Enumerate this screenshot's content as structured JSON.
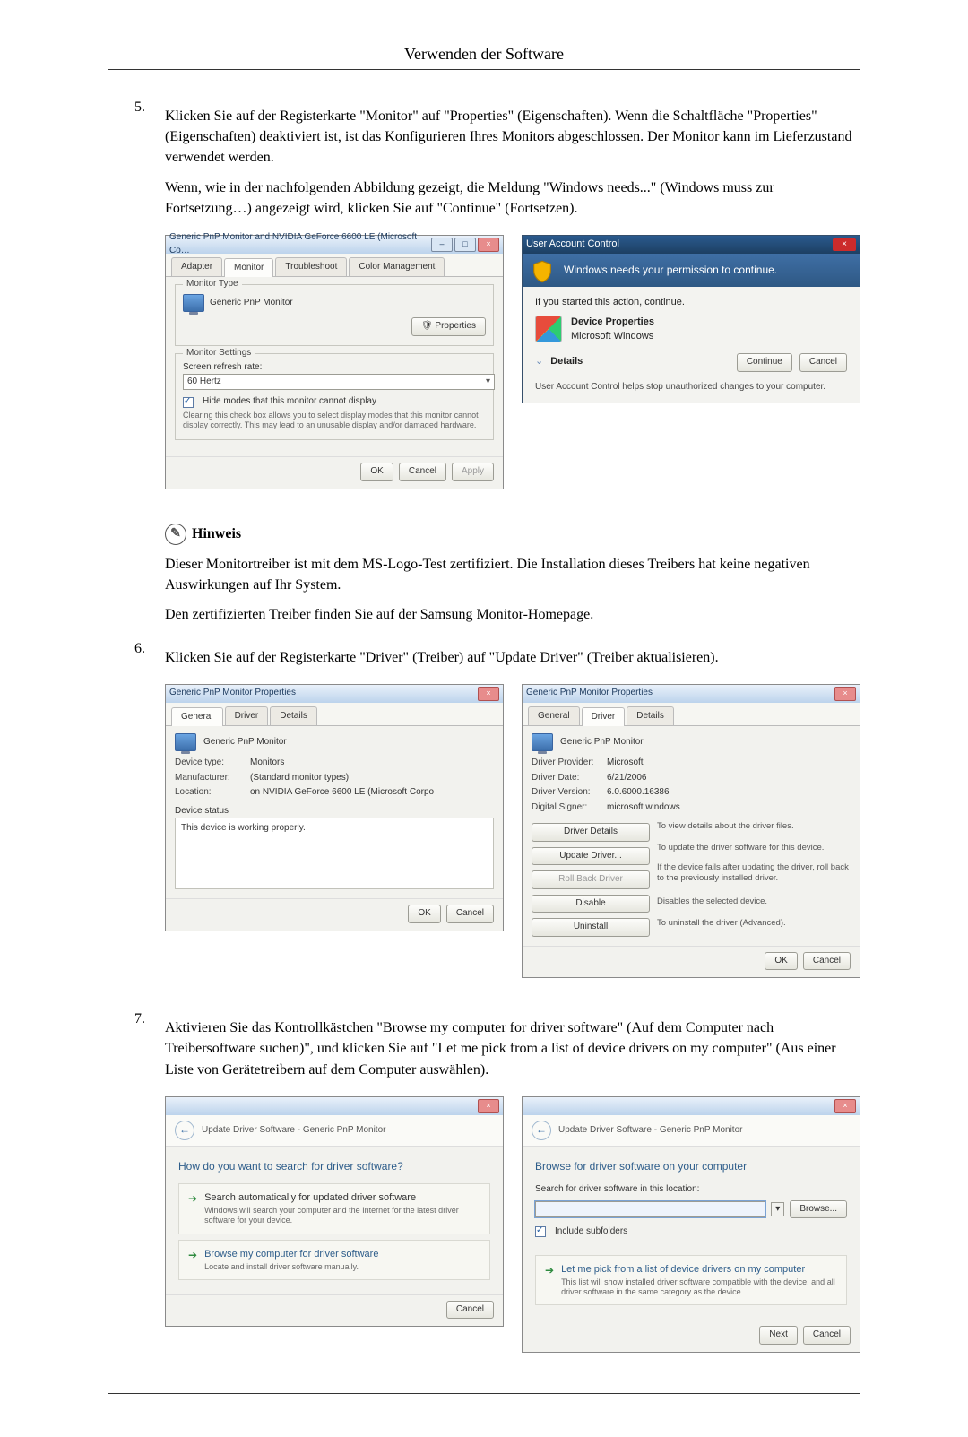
{
  "header": {
    "title": "Verwenden der Software"
  },
  "step5": {
    "num": "5.",
    "p1": "Klicken Sie auf der Registerkarte \"Monitor\" auf \"Properties\" (Eigenschaften). Wenn die Schaltfläche \"Properties\" (Eigenschaften) deaktiviert ist, ist das Konfigurieren Ihres Monitors abgeschlossen. Der Monitor kann im Lieferzustand verwendet werden.",
    "p2": "Wenn, wie in der nachfolgenden Abbildung gezeigt, die Meldung \"Windows needs...\" (Windows muss zur Fortsetzung…) angezeigt wird, klicken Sie auf \"Continue\" (Fortsetzen).",
    "monitorDialog": {
      "title": "Generic PnP Monitor and NVIDIA GeForce 6600 LE (Microsoft Co…",
      "tabs": {
        "adapter": "Adapter",
        "monitor": "Monitor",
        "troubleshoot": "Troubleshoot",
        "colormgmt": "Color Management"
      },
      "group_monitorType": "Monitor Type",
      "monitorName": "Generic PnP Monitor",
      "btn_properties": "Properties",
      "group_monitorSettings": "Monitor Settings",
      "lbl_refresh": "Screen refresh rate:",
      "refresh_value": "60 Hertz",
      "chk_hide": "Hide modes that this monitor cannot display",
      "hideHelp": "Clearing this check box allows you to select display modes that this monitor cannot display correctly. This may lead to an unusable display and/or damaged hardware.",
      "btn_ok": "OK",
      "btn_cancel": "Cancel",
      "btn_apply": "Apply"
    },
    "uac": {
      "title": "User Account Control",
      "band": "Windows needs your permission to continue.",
      "line": "If you started this action, continue.",
      "item_title": "Device Properties",
      "item_pub": "Microsoft Windows",
      "expand": "Details",
      "btn_continue": "Continue",
      "btn_cancel": "Cancel",
      "foot": "User Account Control helps stop unauthorized changes to your computer."
    }
  },
  "note": {
    "heading": "Hinweis",
    "p1": "Dieser Monitortreiber ist mit dem MS-Logo-Test zertifiziert. Die Installation dieses Treibers hat keine negativen Auswirkungen auf Ihr System.",
    "p2": "Den zertifizierten Treiber finden Sie auf der Samsung Monitor-Homepage."
  },
  "step6": {
    "num": "6.",
    "p1": "Klicken Sie auf der Registerkarte \"Driver\" (Treiber) auf \"Update Driver\" (Treiber aktualisieren).",
    "propGeneral": {
      "title": "Generic PnP Monitor Properties",
      "tabs": {
        "general": "General",
        "driver": "Driver",
        "details": "Details"
      },
      "deviceName": "Generic PnP Monitor",
      "kv_type": "Device type:",
      "v_type": "Monitors",
      "kv_mfr": "Manufacturer:",
      "v_mfr": "(Standard monitor types)",
      "kv_loc": "Location:",
      "v_loc": "on NVIDIA GeForce 6600 LE (Microsoft Corpo",
      "lbl_status": "Device status",
      "status": "This device is working properly.",
      "btn_ok": "OK",
      "btn_cancel": "Cancel"
    },
    "propDriver": {
      "title": "Generic PnP Monitor Properties",
      "tabs": {
        "general": "General",
        "driver": "Driver",
        "details": "Details"
      },
      "deviceName": "Generic PnP Monitor",
      "kv_provider": "Driver Provider:",
      "v_provider": "Microsoft",
      "kv_date": "Driver Date:",
      "v_date": "6/21/2006",
      "kv_ver": "Driver Version:",
      "v_ver": "6.0.6000.16386",
      "kv_signer": "Digital Signer:",
      "v_signer": "microsoft windows",
      "btn_details": "Driver Details",
      "desc_details": "To view details about the driver files.",
      "btn_update": "Update Driver...",
      "desc_update": "To update the driver software for this device.",
      "btn_rollback": "Roll Back Driver",
      "desc_rollback": "If the device fails after updating the driver, roll back to the previously installed driver.",
      "btn_disable": "Disable",
      "desc_disable": "Disables the selected device.",
      "btn_uninstall": "Uninstall",
      "desc_uninstall": "To uninstall the driver (Advanced).",
      "btn_ok": "OK",
      "btn_cancel": "Cancel"
    }
  },
  "step7": {
    "num": "7.",
    "p1": "Aktivieren Sie das Kontrollkästchen \"Browse my computer for driver software\" (Auf dem Computer nach Treibersoftware suchen)\", und klicken Sie auf \"Let me pick from a list of device drivers on my computer\" (Aus einer Liste von Gerätetreibern auf dem Computer auswählen).",
    "wizA": {
      "crumb": "Update Driver Software - Generic PnP Monitor",
      "heading": "How do you want to search for driver software?",
      "opt1_title": "Search automatically for updated driver software",
      "opt1_sub": "Windows will search your computer and the Internet for the latest driver software for your device.",
      "opt2_title": "Browse my computer for driver software",
      "opt2_sub": "Locate and install driver software manually.",
      "btn_cancel": "Cancel"
    },
    "wizB": {
      "crumb": "Update Driver Software - Generic PnP Monitor",
      "heading": "Browse for driver software on your computer",
      "lbl_path": "Search for driver software in this location:",
      "btn_browse": "Browse...",
      "chk_include": "Include subfolders",
      "opt_title": "Let me pick from a list of device drivers on my computer",
      "opt_sub": "This list will show installed driver software compatible with the device, and all driver software in the same category as the device.",
      "btn_next": "Next",
      "btn_cancel": "Cancel"
    }
  }
}
